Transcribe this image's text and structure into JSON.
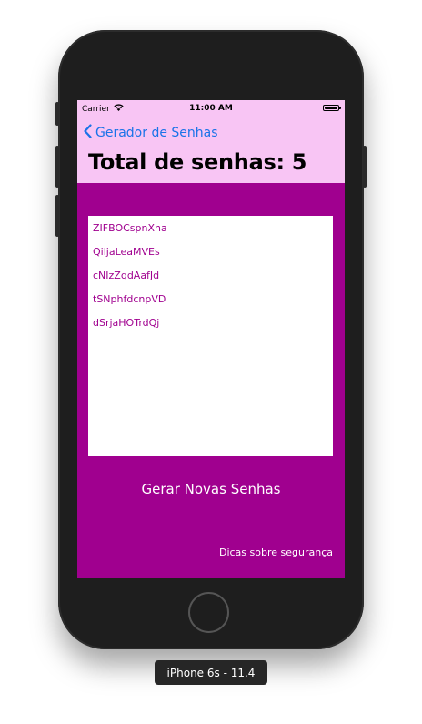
{
  "status_bar": {
    "carrier": "Carrier",
    "time": "11:00 AM",
    "wifi_icon": "wifi-icon",
    "battery_icon": "battery-icon"
  },
  "nav": {
    "back_label": "Gerador de Senhas",
    "title": "Total de senhas: 5",
    "background": "#f8c5f4",
    "tint": "#1a73e8"
  },
  "passwords": [
    "ZIFBOCspnXna",
    "QiljaLeaMVEs",
    "cNIzZqdAafJd",
    "tSNphfdcnpVD",
    "dSrjaHOTrdQj"
  ],
  "actions": {
    "generate_label": "Gerar Novas Senhas",
    "tips_label": "Dicas sobre segurança"
  },
  "theme": {
    "background": "#a0008f",
    "text_on_background": "#ffffff"
  },
  "device_label": "iPhone 6s - 11.4"
}
